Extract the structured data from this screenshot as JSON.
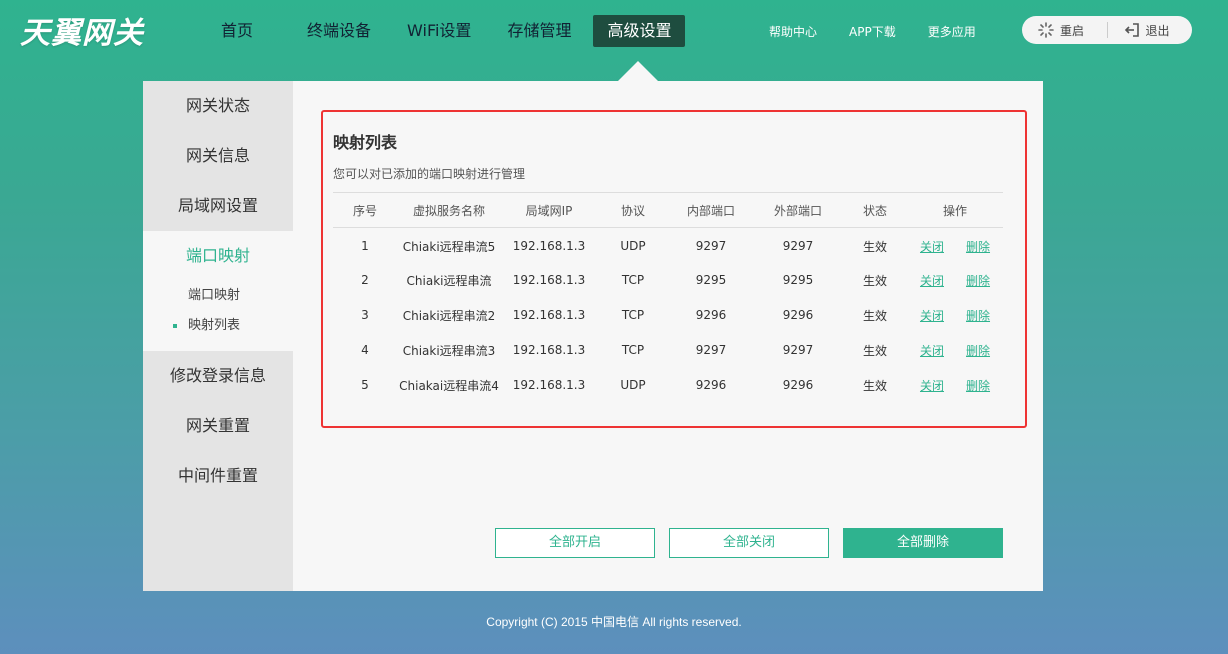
{
  "brand": {
    "logo_text": "天翼网关"
  },
  "nav": {
    "items": [
      {
        "label": "首页"
      },
      {
        "label": "终端设备"
      },
      {
        "label": "WiFi设置"
      },
      {
        "label": "存储管理"
      },
      {
        "label": "高级设置",
        "active": true
      }
    ]
  },
  "top_links": [
    "帮助中心",
    "APP下载",
    "更多应用"
  ],
  "top_actions": {
    "restart_label": "重启",
    "logout_label": "退出"
  },
  "sidebar": {
    "items": [
      {
        "label": "网关状态"
      },
      {
        "label": "网关信息"
      },
      {
        "label": "局域网设置"
      },
      {
        "label": "端口映射",
        "active": true
      },
      {
        "label": "修改登录信息"
      },
      {
        "label": "网关重置"
      },
      {
        "label": "中间件重置"
      }
    ],
    "subitems": [
      {
        "label": "端口映射"
      },
      {
        "label": "映射列表",
        "active": true
      }
    ]
  },
  "mapping": {
    "title": "映射列表",
    "description": "您可以对已添加的端口映射进行管理",
    "columns": [
      "序号",
      "虚拟服务名称",
      "局域网IP",
      "协议",
      "内部端口",
      "外部端口",
      "状态",
      "操作"
    ],
    "rows": [
      [
        "1",
        "Chiaki远程串流5",
        "192.168.1.3",
        "UDP",
        "9297",
        "9297",
        "生效"
      ],
      [
        "2",
        "Chiaki远程串流",
        "192.168.1.3",
        "TCP",
        "9295",
        "9295",
        "生效"
      ],
      [
        "3",
        "Chiaki远程串流2",
        "192.168.1.3",
        "TCP",
        "9296",
        "9296",
        "生效"
      ],
      [
        "4",
        "Chiaki远程串流3",
        "192.168.1.3",
        "TCP",
        "9297",
        "9297",
        "生效"
      ],
      [
        "5",
        "Chiakai远程串流4",
        "192.168.1.3",
        "UDP",
        "9296",
        "9296",
        "生效"
      ]
    ],
    "op_close": "关闭",
    "op_delete": "删除"
  },
  "buttons": {
    "enable_all": "全部开启",
    "close_all": "全部关闭",
    "delete_all": "全部删除"
  },
  "footer": {
    "copyright": "Copyright (C) 2015 中国电信 All rights reserved."
  },
  "colors": {
    "accent": "#2fb38f",
    "nav_active": "#1e4d3f",
    "highlight": "#ee3333"
  }
}
